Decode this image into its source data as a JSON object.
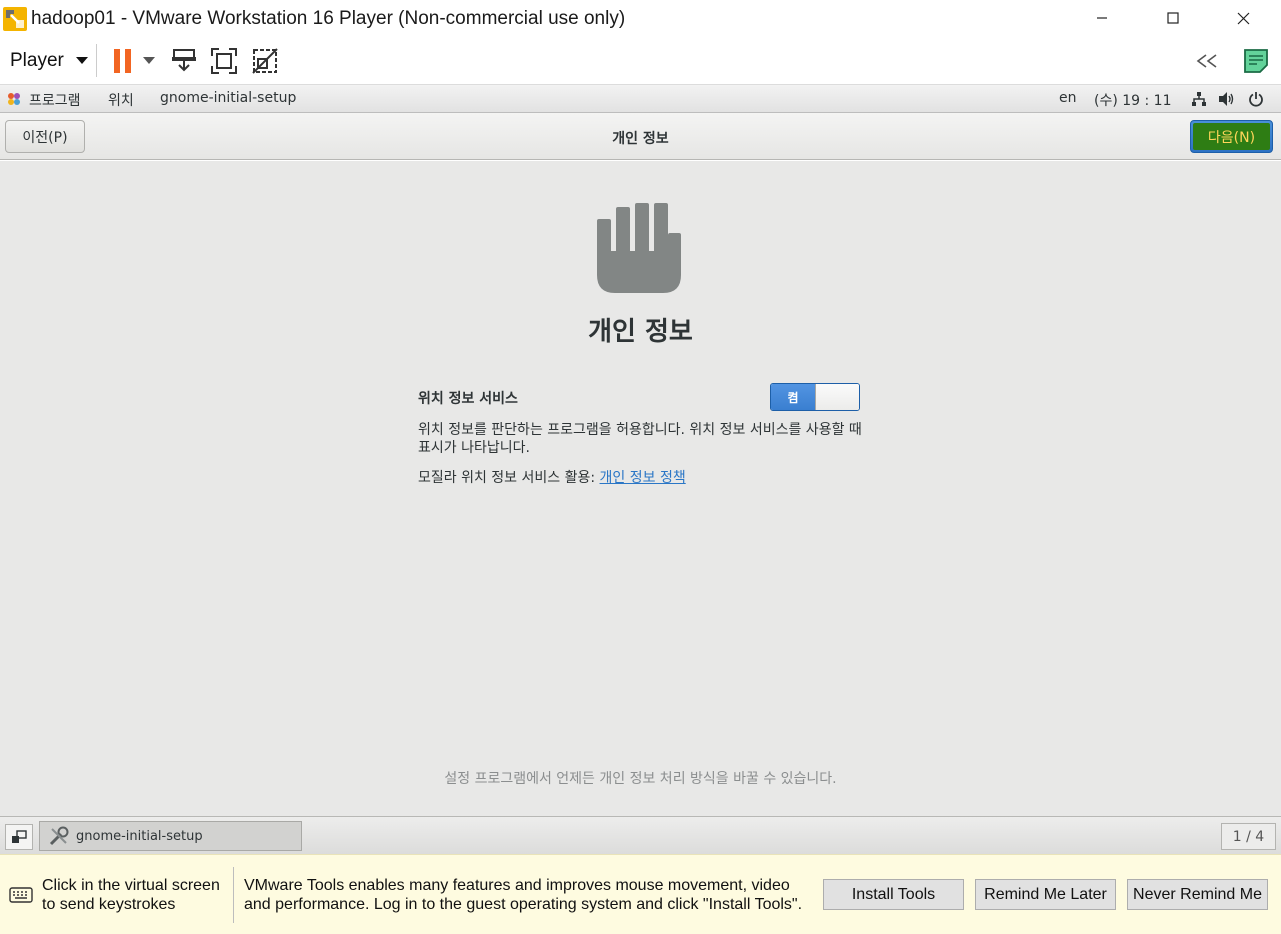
{
  "window": {
    "title": "hadoop01 - VMware Workstation 16 Player (Non-commercial use only)"
  },
  "vm_toolbar": {
    "player_menu": "Player"
  },
  "gnome_topbar": {
    "apps_menu": "프로그램",
    "places_menu": "위치",
    "active_app": "gnome-initial-setup",
    "keyboard_layout": "en",
    "clock": "(수) 19 : 11"
  },
  "setup_header": {
    "prev_label": "이전(P)",
    "title": "개인 정보",
    "next_label": "다음(N)"
  },
  "privacy_page": {
    "heading": "개인 정보",
    "location_service_label": "위치 정보 서비스",
    "toggle_state_label": "켬",
    "location_description": "위치 정보를 판단하는 프로그램을 허용합니다. 위치 정보 서비스를 사용할 때 표시가 나타납니다.",
    "policy_prefix": "모질라 위치 정보 서비스 활용: ",
    "policy_link": "개인 정보 정책",
    "footer_note": "설정 프로그램에서 언제든 개인 정보 처리 방식을 바꿀 수 있습니다."
  },
  "gnome_bottombar": {
    "task_label": "gnome-initial-setup",
    "workspace": "1 / 4"
  },
  "notification": {
    "keystroke_hint": "Click in the virtual screen to send keystrokes",
    "message": "VMware Tools enables many features and improves mouse movement, video and performance. Log in to the guest operating system and click \"Install Tools\".",
    "install_button": "Install Tools",
    "remind_button": "Remind Me Later",
    "never_button": "Never Remind Me"
  },
  "colors": {
    "pause_orange": "#f26522",
    "next_button_fill": "#2e7d14",
    "toggle_blue": "#3a7fd0",
    "link_blue": "#2a76c6",
    "content_bg": "#e8e8e7"
  },
  "icons": [
    "vmware-logo-icon",
    "minimize-icon",
    "maximize-icon",
    "close-icon",
    "dropdown-arrow-icon",
    "pause-icon",
    "send-ctrl-alt-del-icon",
    "fullscreen-icon",
    "unity-icon",
    "collapse-icon",
    "notes-icon",
    "gnome-apps-icon",
    "network-icon",
    "volume-icon",
    "power-icon",
    "hand-stop-icon",
    "show-desktop-icon",
    "setup-tools-icon",
    "keyboard-icon"
  ]
}
